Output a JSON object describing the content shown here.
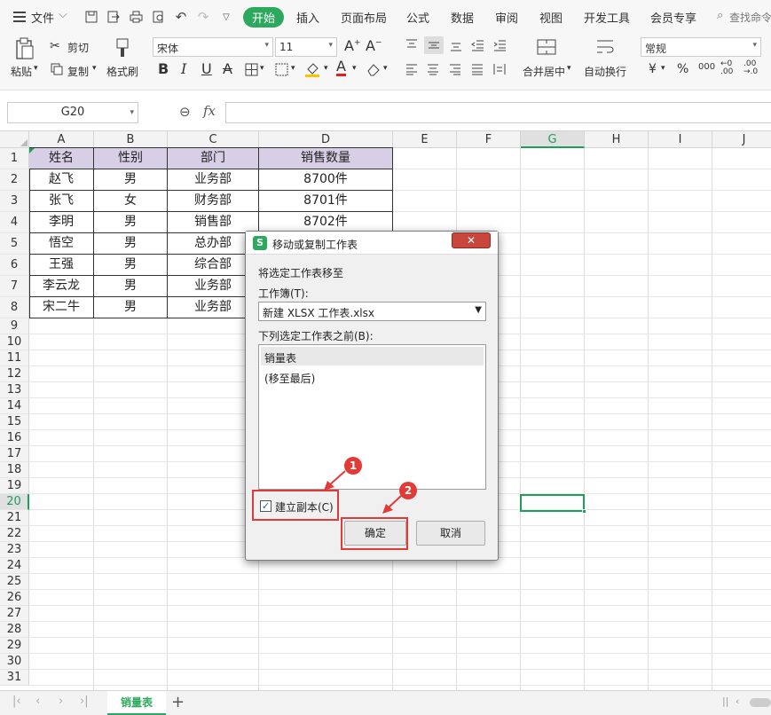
{
  "menubar": {
    "file_label": "文件",
    "tabs": [
      {
        "label": "开始",
        "active": true
      },
      {
        "label": "插入"
      },
      {
        "label": "页面布局"
      },
      {
        "label": "公式"
      },
      {
        "label": "数据"
      },
      {
        "label": "审阅"
      },
      {
        "label": "视图"
      },
      {
        "label": "开发工具"
      },
      {
        "label": "会员专享"
      }
    ],
    "search_label": "查找命令"
  },
  "ribbon": {
    "paste": "粘贴",
    "cut": "剪切",
    "copy": "复制",
    "format_painter": "格式刷",
    "font_name": "宋体",
    "font_size": "11",
    "merge_center": "合并居中",
    "wrap_text": "自动换行",
    "number_format": "常规",
    "currency_symbol": "¥",
    "percent_symbol": "%",
    "thousands_symbol": "000"
  },
  "formula_bar": {
    "cell_ref": "G20",
    "fx_label": "fx",
    "formula_value": ""
  },
  "sheet": {
    "columns": [
      "A",
      "B",
      "C",
      "D",
      "E",
      "F",
      "G",
      "H",
      "I",
      "J"
    ],
    "rows": [
      "1",
      "2",
      "3",
      "4",
      "5",
      "6",
      "7",
      "8",
      "9",
      "10",
      "11",
      "12",
      "13",
      "14",
      "15",
      "16",
      "17",
      "18",
      "19",
      "20",
      "21",
      "22",
      "23",
      "24",
      "25",
      "26",
      "27",
      "28",
      "29",
      "30",
      "31"
    ],
    "header_row": [
      "姓名",
      "性别",
      "部门",
      "销售数量"
    ],
    "data_rows": [
      [
        "赵飞",
        "男",
        "业务部",
        "8700件"
      ],
      [
        "张飞",
        "女",
        "财务部",
        "8701件"
      ],
      [
        "李明",
        "男",
        "销售部",
        "8702件"
      ],
      [
        "悟空",
        "男",
        "总办部",
        ""
      ],
      [
        "王强",
        "男",
        "综合部",
        ""
      ],
      [
        "李云龙",
        "男",
        "业务部",
        ""
      ],
      [
        "宋二牛",
        "男",
        "业务部",
        ""
      ]
    ]
  },
  "sheet_tabs": {
    "active": "销量表",
    "add_label": "+"
  },
  "dialog": {
    "title": "移动或复制工作表",
    "move_to_label": "将选定工作表移至",
    "workbook_label": "工作簿(T):",
    "workbook_value": "新建 XLSX 工作表.xlsx",
    "before_sheet_label": "下列选定工作表之前(B):",
    "sheet_list": [
      "销量表",
      "(移至最后)"
    ],
    "copy_checkbox_label": "建立副本(C)",
    "copy_checked": true,
    "ok_label": "确定",
    "cancel_label": "取消"
  },
  "annotations": {
    "badge1": "1",
    "badge2": "2"
  },
  "colors": {
    "accent_green": "#2ca95e",
    "header_purple": "#d8cfe6",
    "annotation_red": "#e23a36"
  }
}
